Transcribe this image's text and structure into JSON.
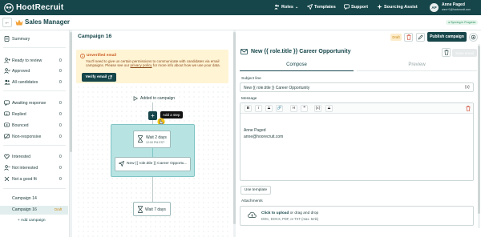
{
  "topbar": {
    "logo_text": "HootRecruit",
    "nav": [
      {
        "label": "Roles",
        "icon": "people-icon"
      },
      {
        "label": "Templates",
        "icon": "paper-plane-icon"
      },
      {
        "label": "Support",
        "icon": "chat-icon"
      },
      {
        "label": "Sourcing Assist",
        "icon": "sparkle-icon"
      }
    ],
    "avatar_initials": "AP",
    "user_name": "Anne Paged",
    "user_email": "anne+1@hootrecruit.com"
  },
  "subheader": {
    "title": "Sales Manager",
    "syncing": "● Syncing in Progress"
  },
  "sidebar": {
    "stages": [
      {
        "label": "Summary",
        "count": "",
        "icon": "document-icon"
      },
      {
        "label": "Ready to review",
        "count": "0",
        "icon": "user-plus-icon"
      },
      {
        "label": "Approved",
        "count": "0",
        "icon": "user-check-icon"
      },
      {
        "label": "All candidates",
        "count": "0",
        "icon": "users-icon"
      },
      {
        "label": "Awaiting response",
        "count": "0",
        "icon": "chat-bubble-icon"
      },
      {
        "label": "Replied",
        "count": "0",
        "icon": "reply-icon"
      },
      {
        "label": "Bounced",
        "count": "0",
        "icon": "bounce-icon"
      },
      {
        "label": "Non-responsive",
        "count": "0",
        "icon": "chat-off-icon"
      },
      {
        "label": "Interested",
        "count": "0",
        "icon": "heart-icon"
      },
      {
        "label": "Not interested",
        "count": "0",
        "icon": "user-minus-icon"
      },
      {
        "label": "Not a good fit",
        "count": "0",
        "icon": "x-icon"
      }
    ],
    "campaigns": [
      {
        "label": "Campaign 14",
        "tag": ""
      },
      {
        "label": "Campaign 16",
        "tag": "Draft"
      }
    ],
    "add_campaign": "+ Add campaign"
  },
  "campaign": {
    "title": "Campaign 16",
    "warning_title": "Unverified email",
    "warning_body_1": "You'll need to give us certain permissions to communicate with candidates via email campaigns. Please see our ",
    "warning_link": "privacy policy",
    "warning_body_2": " for more info about how we use your data.",
    "verify_label": "Verify email",
    "trigger_label": "Added to campaign",
    "tooltip": "Add a step",
    "wait1_title": "Wait 2 days",
    "wait1_sub": "12:00 PM EST",
    "email_step": "New {{ role.title }} Career Opportu...",
    "wait2_title": "Wait 7 days"
  },
  "actions": {
    "draft_badge": "Draft",
    "publish_label": "Publish campaign"
  },
  "email_editor": {
    "title": "New {{ role.title }} Career Opportunity",
    "save_label": "Save email",
    "tab_compose": "Compose",
    "tab_preview": "Preview",
    "subject_label": "Subject line",
    "subject_value": "New {{ role.title }} Career Opportunity",
    "subject_var": "{x}",
    "message_label": "Message",
    "toolbar": [
      "B",
      "I",
      "S",
      "🔗",
      "H",
      "❝",
      "{x}",
      "A"
    ],
    "body_name": "Anne Paged",
    "body_email": "anne@hoorecruit.com",
    "use_template": "Use template",
    "attachments_label": "Attachments",
    "attach_main_strong": "Click to upload",
    "attach_main_rest": " or drag and drop",
    "attach_sub": "DOC, DOCX, PDF, or TXT (max. 5mb)"
  },
  "colors": {
    "brand": "#16464a",
    "warning_bg": "#fff4d4",
    "sequence_bg": "#b8e3e3",
    "draft": "#c98a12"
  }
}
